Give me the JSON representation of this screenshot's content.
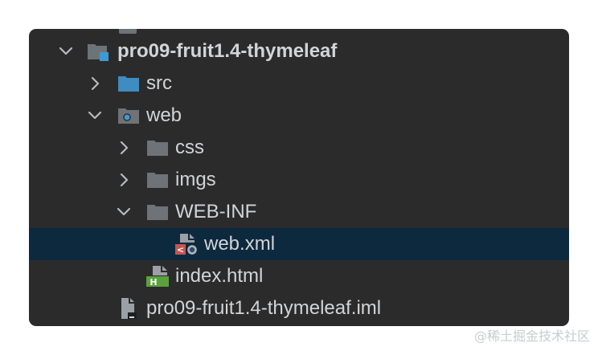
{
  "tree": {
    "project_name": "pro09-fruit1.4-thymeleaf",
    "src_label": "src",
    "web_label": "web",
    "css_label": "css",
    "imgs_label": "imgs",
    "webinf_label": "WEB-INF",
    "webxml_label": "web.xml",
    "index_label": "index.html",
    "iml_label": "pro09-fruit1.4-thymeleaf.iml",
    "index_badge": "H",
    "webxml_badge": "<"
  },
  "watermark": "@稀土掘金技术社区",
  "colors": {
    "panel_background": "#2b2b2c",
    "selected_row": "#0d293e",
    "text": "#d2d4d6",
    "folder": "#6e7378",
    "source_folder": "#3f8cc0",
    "module_badge": "#3d9bd4",
    "html_badge": "#5aa23c",
    "xml_badge": "#c75450"
  },
  "icons": {
    "expanded": "chevron-down-icon",
    "collapsed": "chevron-right-icon",
    "module": "module-folder-icon",
    "source": "source-folder-icon",
    "web": "web-folder-icon",
    "folder": "folder-icon",
    "xml": "xml-file-icon",
    "html": "html-file-icon",
    "iml": "iml-file-icon"
  },
  "expanded_state": {
    "project": true,
    "src": false,
    "web": true,
    "css": false,
    "imgs": false,
    "web_inf": true
  },
  "selected_item": "web.xml"
}
